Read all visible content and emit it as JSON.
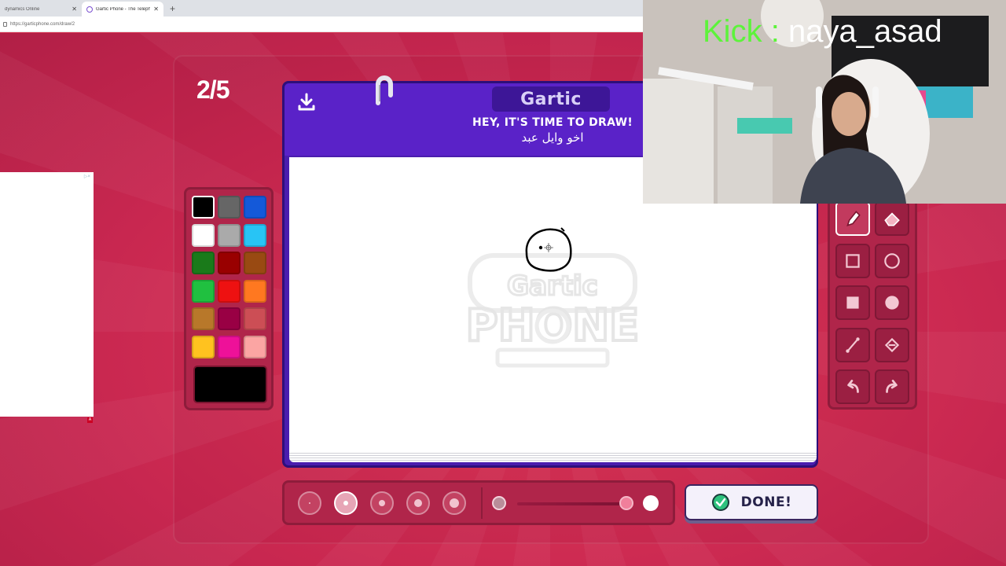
{
  "browser": {
    "tabs": [
      {
        "label": "dynamics Online",
        "active": false
      },
      {
        "label": "Gartic Phone - The Telephone Gar",
        "active": true
      }
    ],
    "new_tab": "+",
    "url": "https://garticphone.com/draw/2"
  },
  "game": {
    "round": "2/5",
    "logo": "Gartic",
    "prompt_title": "HEY, IT'S TIME TO DRAW!",
    "prompt_word": "اخو وايل عبد",
    "watermark": "Gartic PHONE",
    "done_label": "DONE!",
    "palette": {
      "colors": [
        "#000000",
        "#666666",
        "#1459d9",
        "#ffffff",
        "#aaaaaa",
        "#28c4f5",
        "#1a7a1a",
        "#990000",
        "#994a12",
        "#20c040",
        "#ee1111",
        "#ff7820",
        "#b8782a",
        "#990044",
        "#cc4e55",
        "#ffc21f",
        "#ee1199",
        "#fba5a3"
      ],
      "selected_index": 0,
      "current_color": "#000000"
    },
    "tools": [
      "pen-icon",
      "eraser-icon",
      "rectangle-outline-icon",
      "circle-outline-icon",
      "rectangle-fill-icon",
      "circle-fill-icon",
      "line-icon",
      "bucket-icon",
      "undo-icon",
      "redo-icon"
    ],
    "selected_tool": "pen-icon",
    "brush_sizes_selected": 2
  },
  "ad": {
    "mark": "▷×",
    "badge": "A"
  },
  "webcam": {
    "platform": "Kick",
    "separator": ":",
    "username": "naya_asad"
  }
}
